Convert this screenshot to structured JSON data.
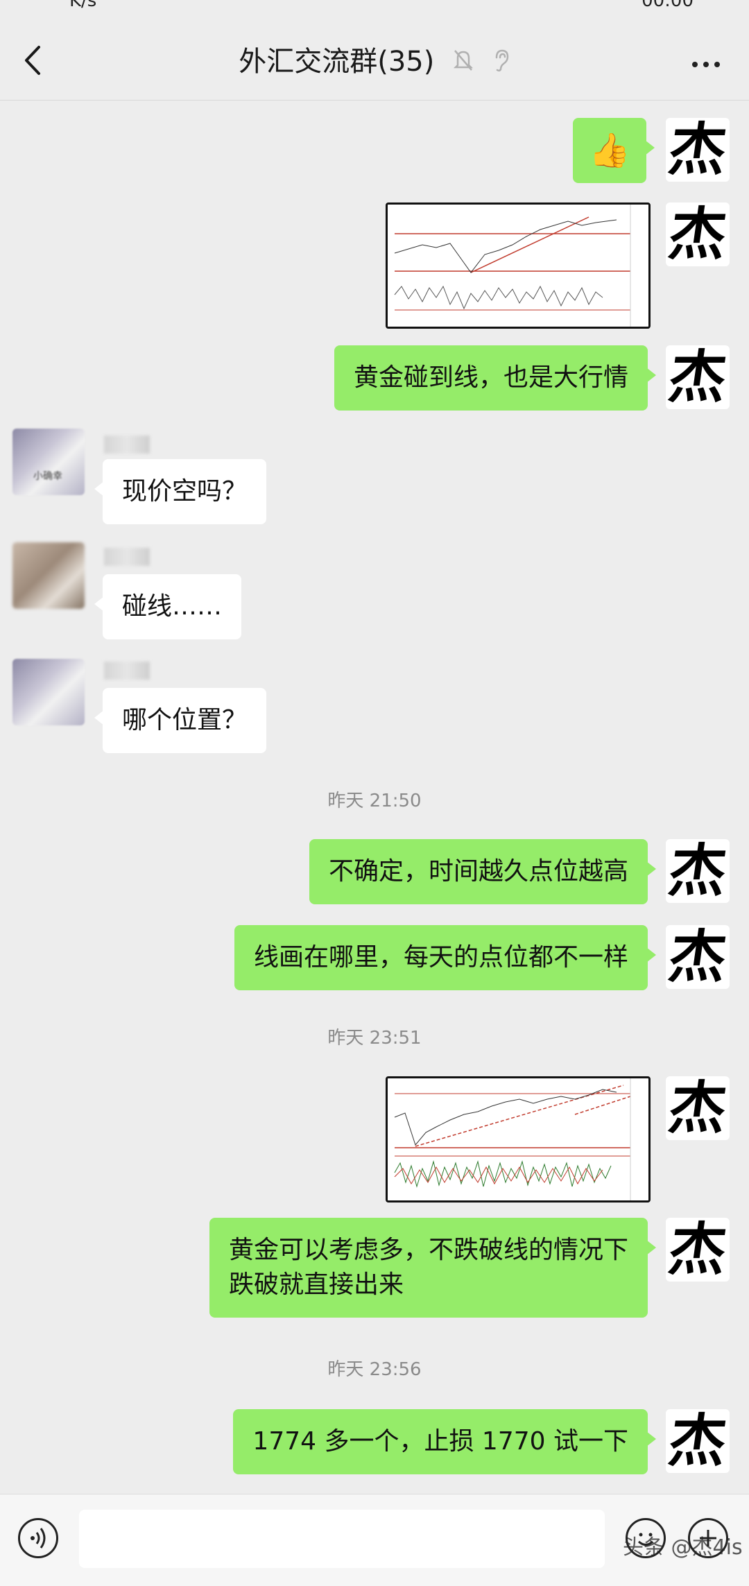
{
  "status_bar": {
    "speed": "K/s",
    "time": "00:00"
  },
  "header": {
    "title": "外汇交流群(35)",
    "mute_icon": "bell-slash-icon",
    "ear_icon": "ear-icon"
  },
  "messages": {
    "thumb": {
      "emoji": "👍"
    },
    "m1": {
      "text": "黄金碰到线，也是大行情"
    },
    "q1": {
      "text": "现价空吗？"
    },
    "q2": {
      "text": "碰线……"
    },
    "q3": {
      "text": "哪个位置？"
    },
    "t1": {
      "text": "昨天 21:50"
    },
    "m2": {
      "text": "不确定，时间越久点位越高"
    },
    "m3": {
      "text": "线画在哪里，每天的点位都不一样"
    },
    "t2": {
      "text": "昨天 23:51"
    },
    "m4": {
      "line1": "黄金可以考虑多，不跌破线的情况下",
      "line2": "跌破就直接出来"
    },
    "t3": {
      "text": "昨天 23:56"
    },
    "m5": {
      "text": "1774 多一个，止损 1770 试一下"
    }
  },
  "avatar": {
    "me_char": "杰",
    "other_label": "小确幸"
  },
  "bottom": {
    "watermark": "头条 @杰4is"
  },
  "colors": {
    "me_bubble": "#95ec69",
    "other_bubble": "#ffffff",
    "background": "#ededed"
  }
}
